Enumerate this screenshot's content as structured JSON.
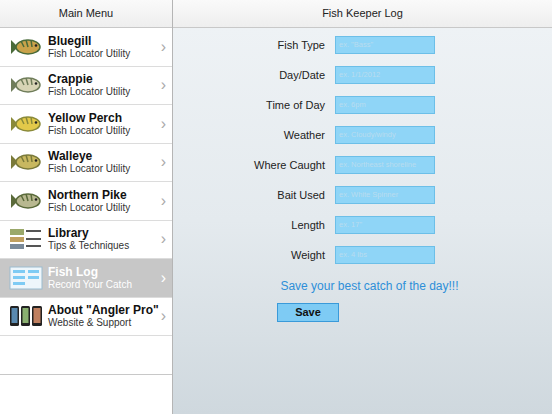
{
  "sidebar": {
    "title": "Main Menu",
    "chevron": "›",
    "items": [
      {
        "title": "Bluegill",
        "subtitle": "Fish Locator Utility",
        "kind": "fish",
        "selected": false
      },
      {
        "title": "Crappie",
        "subtitle": "Fish Locator Utility",
        "kind": "fish",
        "selected": false
      },
      {
        "title": "Yellow Perch",
        "subtitle": "Fish Locator Utility",
        "kind": "fish",
        "selected": false
      },
      {
        "title": "Walleye",
        "subtitle": "Fish Locator Utility",
        "kind": "fish",
        "selected": false
      },
      {
        "title": "Northern Pike",
        "subtitle": "Fish Locator Utility",
        "kind": "fish",
        "selected": false
      },
      {
        "title": "Library",
        "subtitle": "Tips & Techniques",
        "kind": "library",
        "selected": false
      },
      {
        "title": "Fish Log",
        "subtitle": "Record Your Catch",
        "kind": "log",
        "selected": true
      },
      {
        "title": "About \"Angler Pro\"",
        "subtitle": "Website & Support",
        "kind": "about",
        "selected": false
      }
    ]
  },
  "form": {
    "title": "Fish Keeper Log",
    "fields": [
      {
        "label": "Fish Type",
        "placeholder": "ex. \"Bass\""
      },
      {
        "label": "Day/Date",
        "placeholder": "ex. 1/1/2012"
      },
      {
        "label": "Time of Day",
        "placeholder": "ex. 6pm"
      },
      {
        "label": "Weather",
        "placeholder": "ex. Cloudy/windy"
      },
      {
        "label": "Where Caught",
        "placeholder": "ex. Northeast shoreline"
      },
      {
        "label": "Bait Used",
        "placeholder": "ex. White Spinner"
      },
      {
        "label": "Length",
        "placeholder": "ex. 17\""
      },
      {
        "label": "Weight",
        "placeholder": "ex. 4 lbs"
      }
    ],
    "message": "Save your best catch of the day!!!",
    "button": "Save"
  }
}
